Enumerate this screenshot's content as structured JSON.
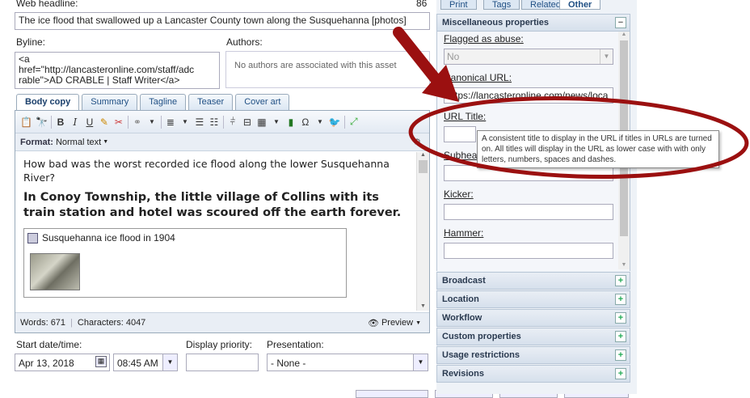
{
  "headline": {
    "label": "Web headline:",
    "count": "86",
    "value": "The ice flood that swallowed up a Lancaster County town along the Susquehanna [photos]"
  },
  "byline": {
    "label": "Byline:",
    "value_line1": "<a",
    "value_line2": "href=\"http://lancasteronline.com/staff/adc",
    "value_line3": "rable\">AD CRABLE | Staff Writer</a>"
  },
  "authors": {
    "label": "Authors:",
    "empty_text": "No authors are associated with this asset"
  },
  "editor": {
    "tabs": [
      "Body copy",
      "Summary",
      "Tagline",
      "Teaser",
      "Cover art"
    ],
    "format_label": "Format:",
    "format_value": "Normal text",
    "para1": "How bad was the worst recorded ice flood along the lower Susquehanna River?",
    "heading": "In Conoy Township, the little village of Collins with its train station and hotel was scoured off the earth forever.",
    "image_caption": "Susquehanna ice flood in 1904",
    "words": "Words: 671",
    "characters": "Characters: 4047",
    "preview": "Preview"
  },
  "schedule": {
    "start_label": "Start date/time:",
    "date": "Apr 13, 2018",
    "time": "08:45 AM",
    "priority_label": "Display priority:",
    "priority_value": "",
    "presentation_label": "Presentation:",
    "presentation_value": "- None -"
  },
  "right_panel": {
    "tabs": [
      "Print",
      "Tags",
      "Related",
      "Other"
    ],
    "misc_title": "Miscellaneous properties",
    "flagged_label": "Flagged as abuse:",
    "flagged_value": "No",
    "canonical_label": "Canonical URL:",
    "canonical_value": "https://lancasteronline.com/news/loca",
    "urltitle_label": "URL Title:",
    "subhead_label": "Subhea",
    "kicker_label": "Kicker:",
    "hammer_label": "Hammer:",
    "sections": [
      "Broadcast",
      "Location",
      "Workflow",
      "Custom properties",
      "Usage restrictions",
      "Revisions"
    ]
  },
  "tooltip": {
    "text": "A consistent title to display in the URL if titles in URLs are turned on. All titles will display in the URL as lower case with with only letters, numbers, spaces and dashes."
  },
  "colors": {
    "annotation": "#9b1010",
    "accent": "#1f4f84"
  }
}
